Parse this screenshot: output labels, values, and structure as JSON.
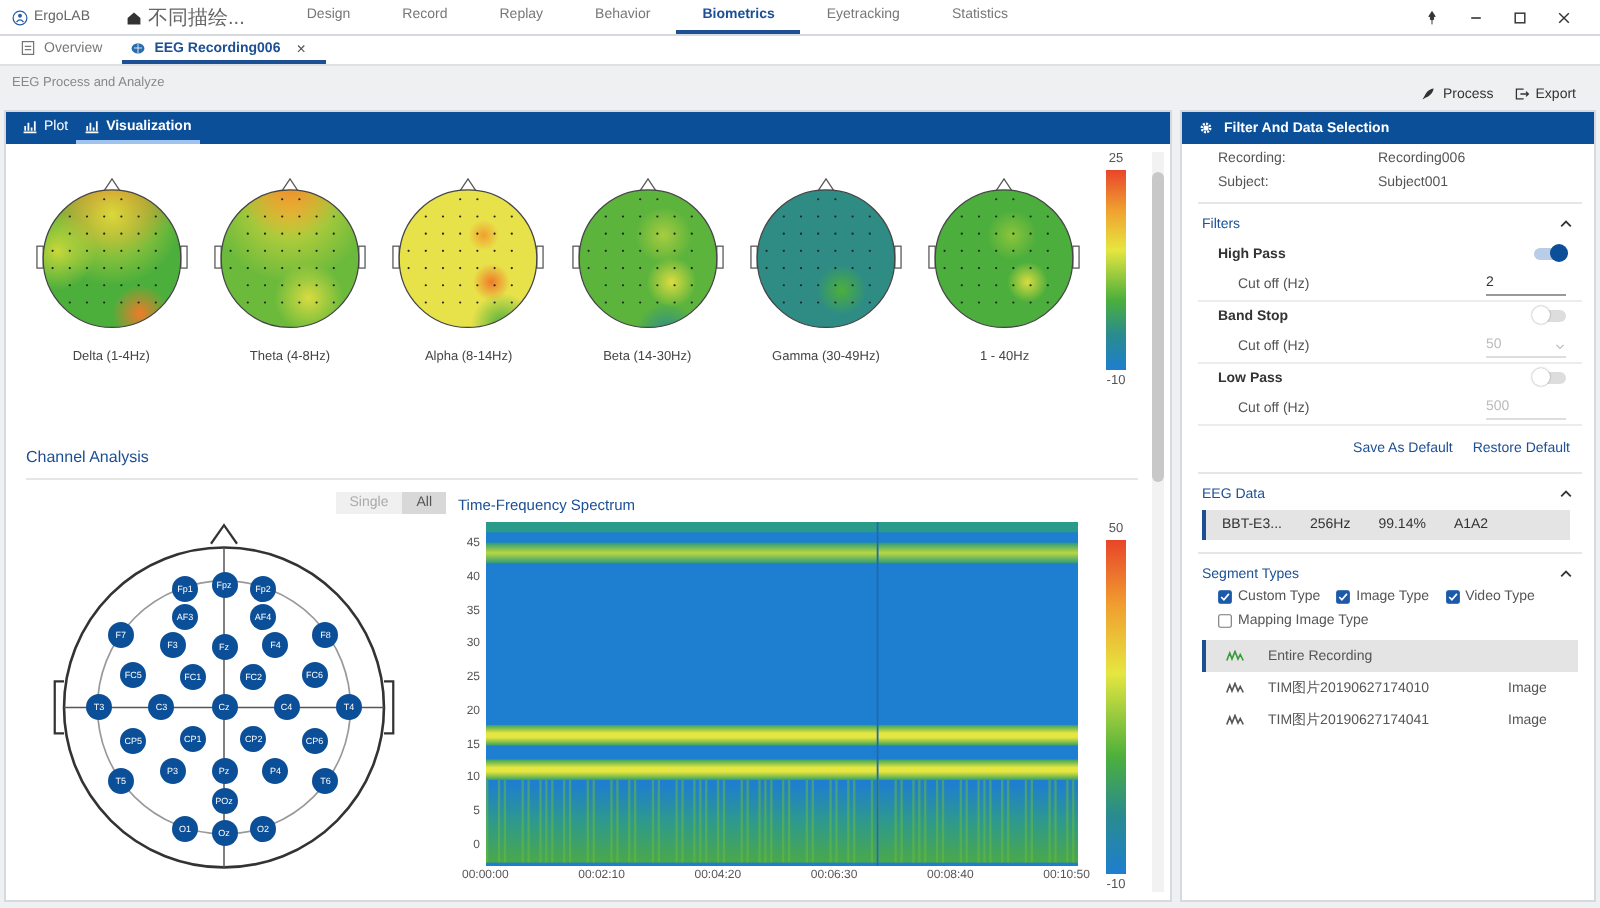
{
  "app": {
    "logo": "ErgoLAB",
    "project": "不同描绘...",
    "nav": [
      {
        "label": "Design",
        "selected": false
      },
      {
        "label": "Record",
        "selected": false
      },
      {
        "label": "Replay",
        "selected": false
      },
      {
        "label": "Behavior",
        "selected": false
      },
      {
        "label": "Biometrics",
        "selected": true
      },
      {
        "label": "Eyetracking",
        "selected": false
      },
      {
        "label": "Statistics",
        "selected": false
      }
    ]
  },
  "doc_tabs": [
    {
      "label": "Overview",
      "selected": false,
      "kind": "overview"
    },
    {
      "label": "EEG Recording006",
      "selected": true,
      "kind": "eeg",
      "close": "×"
    }
  ],
  "breadcrumb": "EEG Process and Analyze",
  "actions": [
    {
      "label": "Process",
      "kind": "process"
    },
    {
      "label": "Export",
      "kind": "export"
    }
  ],
  "left_panel": {
    "tabs": [
      {
        "label": "Plot",
        "selected": false
      },
      {
        "label": "Visualization",
        "selected": true
      }
    ],
    "topomaps": [
      {
        "label": "Delta (1-4Hz)"
      },
      {
        "label": "Theta (4-8Hz)"
      },
      {
        "label": "Alpha (8-14Hz)"
      },
      {
        "label": "Beta (14-30Hz)"
      },
      {
        "label": "Gamma (30-49Hz)"
      },
      {
        "label": "1 - 40Hz"
      }
    ],
    "topo_scale": {
      "max": "25",
      "min": "-10"
    },
    "section_title": "Channel Analysis",
    "view_toggle": [
      {
        "label": "Single",
        "selected": false
      },
      {
        "label": "All",
        "selected": true
      }
    ],
    "electrodes": [
      "Fp1",
      "Fpz",
      "Fp2",
      "AF3",
      "AF4",
      "F7",
      "F3",
      "Fz",
      "F4",
      "F8",
      "FC5",
      "FC1",
      "FC2",
      "FC6",
      "T3",
      "C3",
      "Cz",
      "C4",
      "T4",
      "CP5",
      "CP1",
      "CP2",
      "CP6",
      "T5",
      "P3",
      "Pz",
      "P4",
      "T6",
      "POz",
      "O1",
      "Oz",
      "O2"
    ],
    "spectrum": {
      "title": "Time-Frequency Spectrum",
      "y_ticks": [
        "45",
        "40",
        "35",
        "30",
        "25",
        "20",
        "15",
        "10",
        "5",
        "0"
      ],
      "x_ticks": [
        "00:00:00",
        "00:02:10",
        "00:04:20",
        "00:06:30",
        "00:08:40",
        "00:10:50"
      ],
      "scale": {
        "max": "50",
        "min": "-10"
      }
    }
  },
  "right_panel": {
    "title": "Filter And Data Selection",
    "info": [
      {
        "label": "Recording:",
        "value": "Recording006"
      },
      {
        "label": "Subject:",
        "value": "Subject001"
      }
    ],
    "filters": {
      "title": "Filters",
      "expanded": true,
      "items": [
        {
          "name": "High Pass",
          "on": true,
          "field_label": "Cut off (Hz)",
          "value": "2",
          "kind": "input"
        },
        {
          "name": "Band Stop",
          "on": false,
          "field_label": "Cut off (Hz)",
          "value": "50",
          "kind": "dropdown"
        },
        {
          "name": "Low Pass",
          "on": false,
          "field_label": "Cut off (Hz)",
          "value": "500",
          "kind": "input"
        }
      ]
    },
    "default_actions": [
      "Save As Default",
      "Restore Default"
    ],
    "eeg_data": {
      "title": "EEG Data",
      "expanded": true,
      "rows": [
        {
          "cells": [
            "BBT-E3...",
            "256Hz",
            "99.14%",
            "A1A2"
          ],
          "selected": true
        }
      ]
    },
    "segment_types": {
      "title": "Segment Types",
      "expanded": true,
      "options": [
        {
          "label": "Custom Type",
          "checked": true
        },
        {
          "label": "Image Type",
          "checked": true
        },
        {
          "label": "Video Type",
          "checked": true
        },
        {
          "label": "Mapping Image Type",
          "checked": false
        }
      ],
      "segments": [
        {
          "name": "Entire Recording",
          "selected": true
        },
        {
          "name": "TIM图片20190627174010",
          "type": "Image",
          "selected": false
        },
        {
          "name": "TIM图片20190627174041",
          "type": "Image",
          "selected": false
        }
      ]
    }
  }
}
